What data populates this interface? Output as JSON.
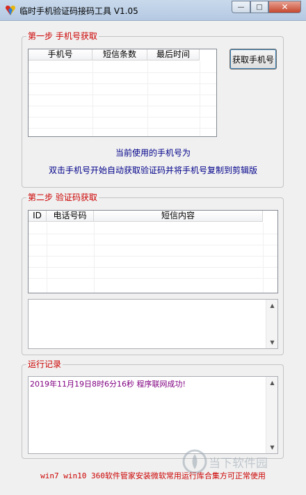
{
  "window": {
    "title": "临时手机验证码接码工具 V1.05",
    "close_label": "✕",
    "min_label": "—",
    "max_label": "□"
  },
  "step1": {
    "legend": "第一步  手机号获取",
    "columns": [
      "手机号",
      "短信条数",
      "最后时间"
    ],
    "button_label": "获取手机号",
    "current_label": "当前使用的手机号为",
    "hint": "双击手机号开始自动获取验证码并将手机号复制到剪辑版"
  },
  "step2": {
    "legend": "第二步  验证码获取",
    "columns": [
      "ID",
      "电话号码",
      "短信内容"
    ]
  },
  "log": {
    "legend": "运行记录",
    "entry": "2019年11月19日8时6分16秒   程序联网成功!"
  },
  "footer": "win7 win10 360软件管家安装微软常用运行库合集方可正常使用",
  "watermark": {
    "text": "当下软件园",
    "icon": "watermark-logo-icon"
  },
  "colors": {
    "legend": "#cc0000",
    "info": "#00008b",
    "log": "#800080"
  }
}
